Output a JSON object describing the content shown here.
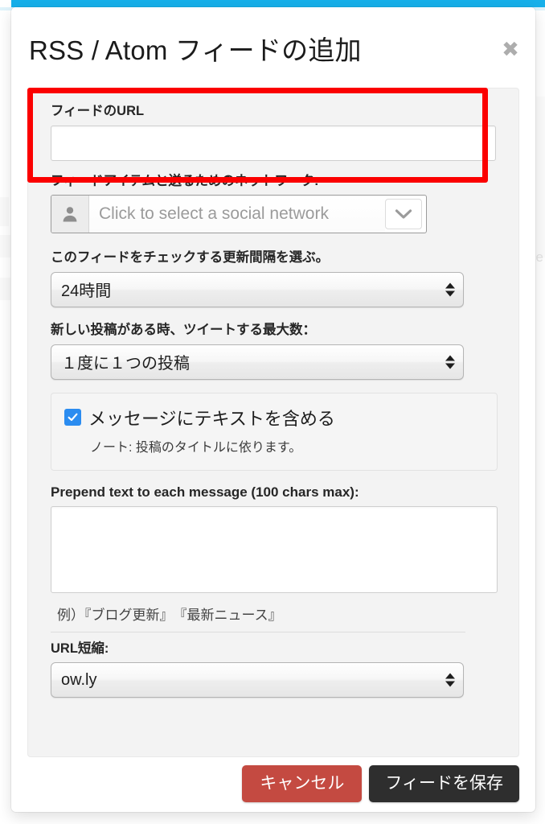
{
  "window": {
    "accent_bar_color": "#17b0ea"
  },
  "modal": {
    "title": "RSS / Atom フィードの追加",
    "close_icon": "close-icon",
    "close_glyph": "✖",
    "fields": {
      "feed_url": {
        "label": "フィードのURL",
        "value": "",
        "placeholder": ""
      },
      "network": {
        "label": "フィードアイテムと送るためのネットワーク:",
        "placeholder": "Click to select a social network",
        "avatar_icon": "person-icon",
        "caret_icon": "chevron-down-icon"
      },
      "interval": {
        "label": "このフィードをチェックする更新間隔を選ぶ。",
        "selected": "24時間"
      },
      "max_posts": {
        "label": "新しい投稿がある時、ツイートする最大数：",
        "selected": "１度に１つの投稿"
      },
      "include_text": {
        "checked": true,
        "label": "メッセージにテキストを含める",
        "note": "ノート: 投稿のタイトルに依ります。"
      },
      "prepend": {
        "label": "Prepend text to each message (100 chars max):",
        "value": "",
        "placeholder": "",
        "example": "例）『ブログ更新』　『最新ニュース』"
      },
      "shortener": {
        "label": "URL短縮:",
        "selected": "ow.ly"
      }
    },
    "footer": {
      "cancel_label": "キャンセル",
      "save_label": "フィードを保存"
    }
  },
  "annotation": {
    "highlight_color": "#fb0000",
    "target": "feed-url-field"
  }
}
